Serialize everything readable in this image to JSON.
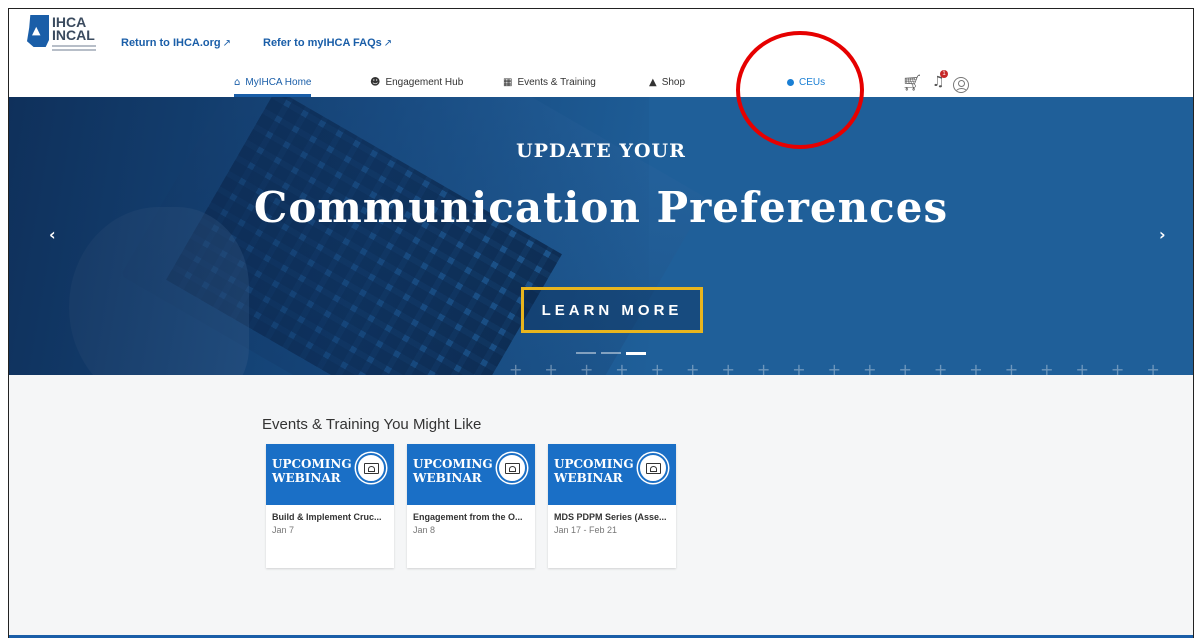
{
  "logo": {
    "line1": "IHCA",
    "line2": "INCAL"
  },
  "top_links": [
    {
      "label": "Return to IHCA.org"
    },
    {
      "label": "Refer to myIHCA FAQs"
    }
  ],
  "nav": [
    {
      "label": "MyIHCA Home",
      "icon": "home-icon",
      "active": true
    },
    {
      "label": "Engagement Hub",
      "icon": "users-icon"
    },
    {
      "label": "Events & Training",
      "icon": "calendar-icon"
    },
    {
      "label": "Shop",
      "icon": "shopping-bag-icon"
    },
    {
      "label": "CEUs",
      "icon": "dot-icon"
    }
  ],
  "utility": {
    "notification_count": "1"
  },
  "hero": {
    "subtitle": "UPDATE YOUR",
    "title": "Communication Preferences",
    "button_label": "LEARN MORE",
    "slide_count": 3,
    "active_slide": 3
  },
  "events": {
    "section_title": "Events & Training You Might Like",
    "cards": [
      {
        "banner_line1": "UPCOMING",
        "banner_line2": "WEBINAR",
        "name": "Build & Implement Cruc...",
        "date": "Jan 7"
      },
      {
        "banner_line1": "UPCOMING",
        "banner_line2": "WEBINAR",
        "name": "Engagement from the O...",
        "date": "Jan 8"
      },
      {
        "banner_line1": "UPCOMING",
        "banner_line2": "WEBINAR",
        "name": "MDS PDPM Series (Asse...",
        "date": "Jan 17 - Feb 21"
      }
    ]
  },
  "colors": {
    "brand_blue": "#1a5ea8",
    "ceus_blue": "#1a7fd4",
    "button_border": "#e8b51e",
    "annotation": "#e60000"
  }
}
